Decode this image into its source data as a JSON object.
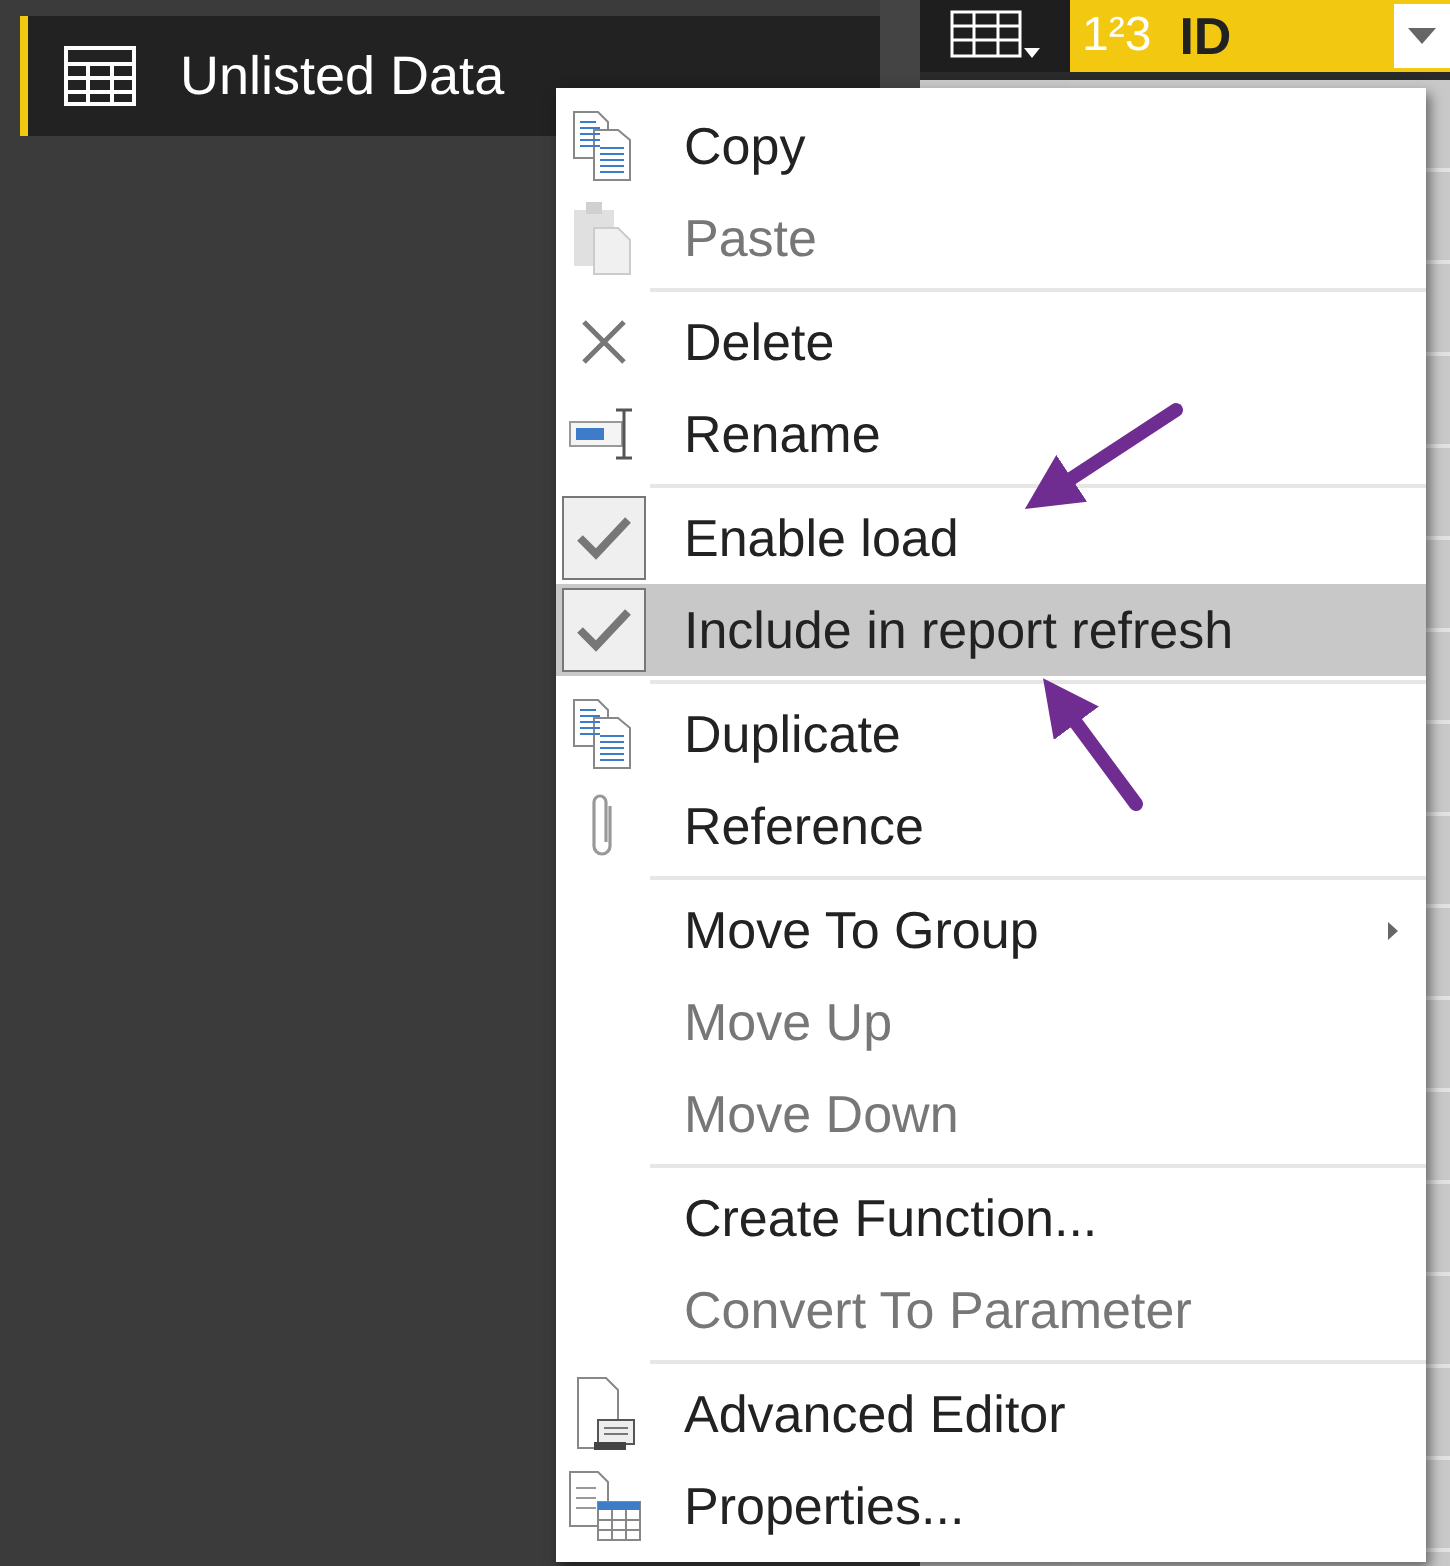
{
  "queries_pane": {
    "items": [
      {
        "label": "Unlisted Data",
        "selected": true
      }
    ]
  },
  "grid": {
    "columns": [
      {
        "label": "ID",
        "type_badge": "1²3"
      }
    ]
  },
  "context_menu": {
    "groups": [
      [
        {
          "label": "Copy",
          "kind": "command",
          "disabled": false,
          "selected": false
        },
        {
          "label": "Paste",
          "kind": "command",
          "disabled": true,
          "selected": false
        }
      ],
      [
        {
          "label": "Delete",
          "kind": "command",
          "disabled": false,
          "selected": false
        },
        {
          "label": "Rename",
          "kind": "command",
          "disabled": false,
          "selected": false
        }
      ],
      [
        {
          "label": "Enable load",
          "kind": "check",
          "checked": true,
          "disabled": false,
          "selected": false
        },
        {
          "label": "Include in report refresh",
          "kind": "check",
          "checked": true,
          "disabled": false,
          "selected": true
        }
      ],
      [
        {
          "label": "Duplicate",
          "kind": "command",
          "disabled": false,
          "selected": false
        },
        {
          "label": "Reference",
          "kind": "command",
          "disabled": false,
          "selected": false
        }
      ],
      [
        {
          "label": "Move To Group",
          "kind": "submenu",
          "disabled": false,
          "selected": false
        },
        {
          "label": "Move Up",
          "kind": "command",
          "disabled": true,
          "selected": false
        },
        {
          "label": "Move Down",
          "kind": "command",
          "disabled": true,
          "selected": false
        }
      ],
      [
        {
          "label": "Create Function...",
          "kind": "command",
          "disabled": false,
          "selected": false
        },
        {
          "label": "Convert To Parameter",
          "kind": "command",
          "disabled": true,
          "selected": false
        }
      ],
      [
        {
          "label": "Advanced Editor",
          "kind": "command",
          "disabled": false,
          "selected": false
        },
        {
          "label": "Properties...",
          "kind": "command",
          "disabled": false,
          "selected": false
        }
      ]
    ]
  }
}
